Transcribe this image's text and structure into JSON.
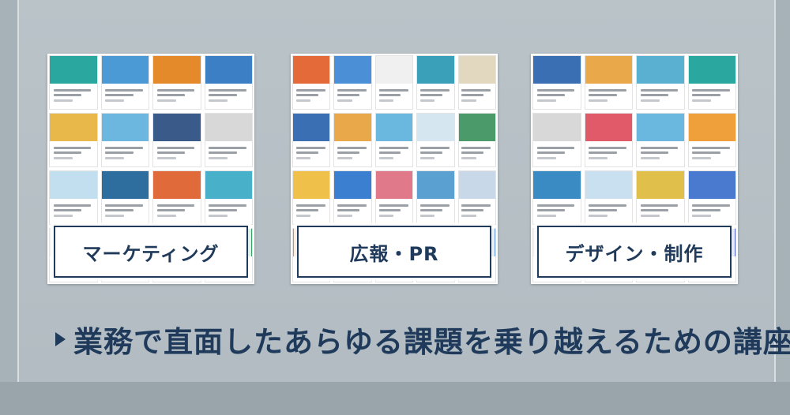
{
  "categories": [
    {
      "label": "マーケティング",
      "mosaic": [
        "#2aa8a0",
        "#4b9ad6",
        "#e58a2a",
        "#3c7fc4",
        "#e9b84a",
        "#6bb7e0",
        "#3a5a8a",
        "#d8d8d8",
        "#c2dff0",
        "#2e6e9e",
        "#e06a3a",
        "#48b0c9",
        "#f0f0f0",
        "#6a7fd0",
        "#e4a23a",
        "#3aa06a"
      ]
    },
    {
      "label": "広報・PR",
      "mosaic": [
        "#e56a3a",
        "#4b8fd6",
        "#f0f0f0",
        "#3aa0b9",
        "#e2d8c0",
        "#3b6fb4",
        "#e9a94a",
        "#6ab7e0",
        "#d6e6f0",
        "#4a9a6a",
        "#f0c14a",
        "#3a7fd0",
        "#e07a8a",
        "#5aa0d0",
        "#c8d8e8",
        "#f08a3a",
        "#3a6aa0",
        "#4ab0a0",
        "#e0e0e0",
        "#6a9ad6"
      ]
    },
    {
      "label": "デザイン・制作",
      "mosaic": [
        "#3a6fb4",
        "#e9a94a",
        "#5ab0d0",
        "#2aa8a0",
        "#d8d8d8",
        "#e05a6a",
        "#6ab7e0",
        "#f0a03a",
        "#3a8ac4",
        "#c8e0f0",
        "#e0c04a",
        "#4a7ad0",
        "#f2f2f2",
        "#e58a2a",
        "#3aa0b9",
        "#5a6ad0"
      ]
    }
  ],
  "tagline": "業務で直面したあらゆる課題を乗り越えるための講座群",
  "colors": {
    "navy": "#1f3a5a",
    "background": "#b2bcc2"
  }
}
